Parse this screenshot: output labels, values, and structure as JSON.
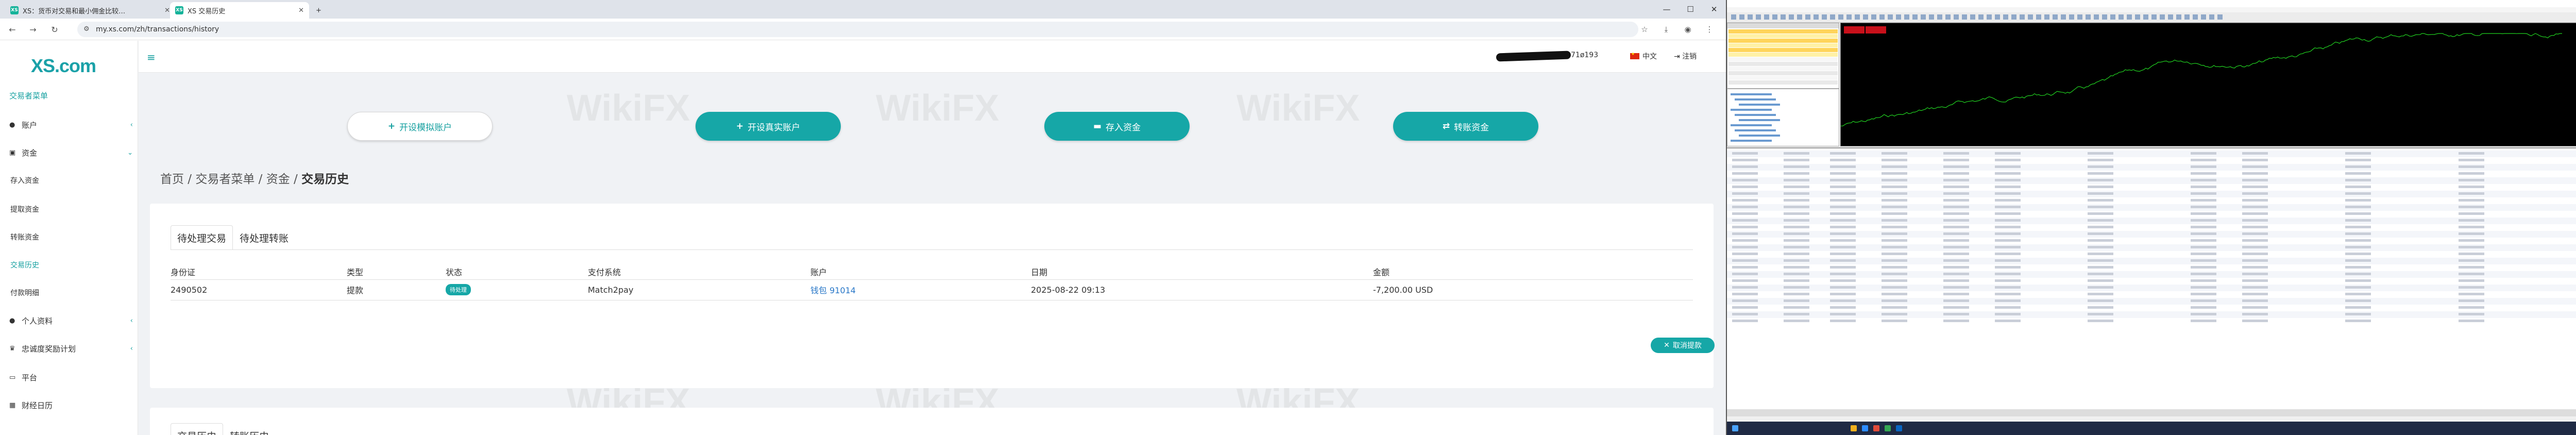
{
  "browser": {
    "tabs": [
      {
        "favicon": "XS",
        "title": "XS：货币对交易和最小佣金比较…",
        "active": false
      },
      {
        "favicon": "XS",
        "title": "XS 交易历史",
        "active": true
      }
    ],
    "url": "my.xs.com/zh/transactions/history"
  },
  "sidebar": {
    "logo": "XS.com",
    "section_title": "交易者菜单",
    "items": [
      {
        "label": "账户",
        "icon": "user-icon",
        "expandable": true
      },
      {
        "label": "资金",
        "icon": "money-icon",
        "expandable": true
      },
      {
        "label": "存入资金",
        "sub": true
      },
      {
        "label": "提取资金",
        "sub": true
      },
      {
        "label": "转账资金",
        "sub": true
      },
      {
        "label": "交易历史",
        "sub": true,
        "active": true
      },
      {
        "label": "付款明细",
        "sub": true
      },
      {
        "label": "个人资料",
        "icon": "user-icon",
        "expandable": true
      },
      {
        "label": "忠诚度奖励计划",
        "icon": "trophy-icon",
        "expandable": true
      },
      {
        "label": "平台",
        "icon": "desktop-icon"
      },
      {
        "label": "财经日历",
        "icon": "calendar-icon"
      }
    ]
  },
  "header": {
    "user_id": "71ø193",
    "language": "中文",
    "logout": "注销"
  },
  "actions": {
    "demo": "开设模拟账户",
    "live": "开设真实账户",
    "deposit": "存入资金",
    "transfer": "转账资金"
  },
  "breadcrumb": [
    "首页",
    "交易者菜单",
    "资金",
    "交易历史"
  ],
  "pending": {
    "tabs": [
      "待处理交易",
      "待处理转账"
    ],
    "columns": [
      "身份证",
      "类型",
      "状态",
      "支付系统",
      "账户",
      "日期",
      "金额"
    ],
    "rows": [
      {
        "id": "2490502",
        "type": "提款",
        "status": "待处理",
        "system": "Match2pay",
        "account": "钱包 91014",
        "date": "2025-08-22 09:13",
        "amount": "-7,200.00 USD"
      }
    ],
    "cancel_label": "取消提款"
  },
  "history": {
    "tabs": [
      "交易历史",
      "转账历史"
    ]
  },
  "watermark": "WikiFX",
  "colors": {
    "accent": "#16a7a7",
    "link": "#2a78c8"
  }
}
